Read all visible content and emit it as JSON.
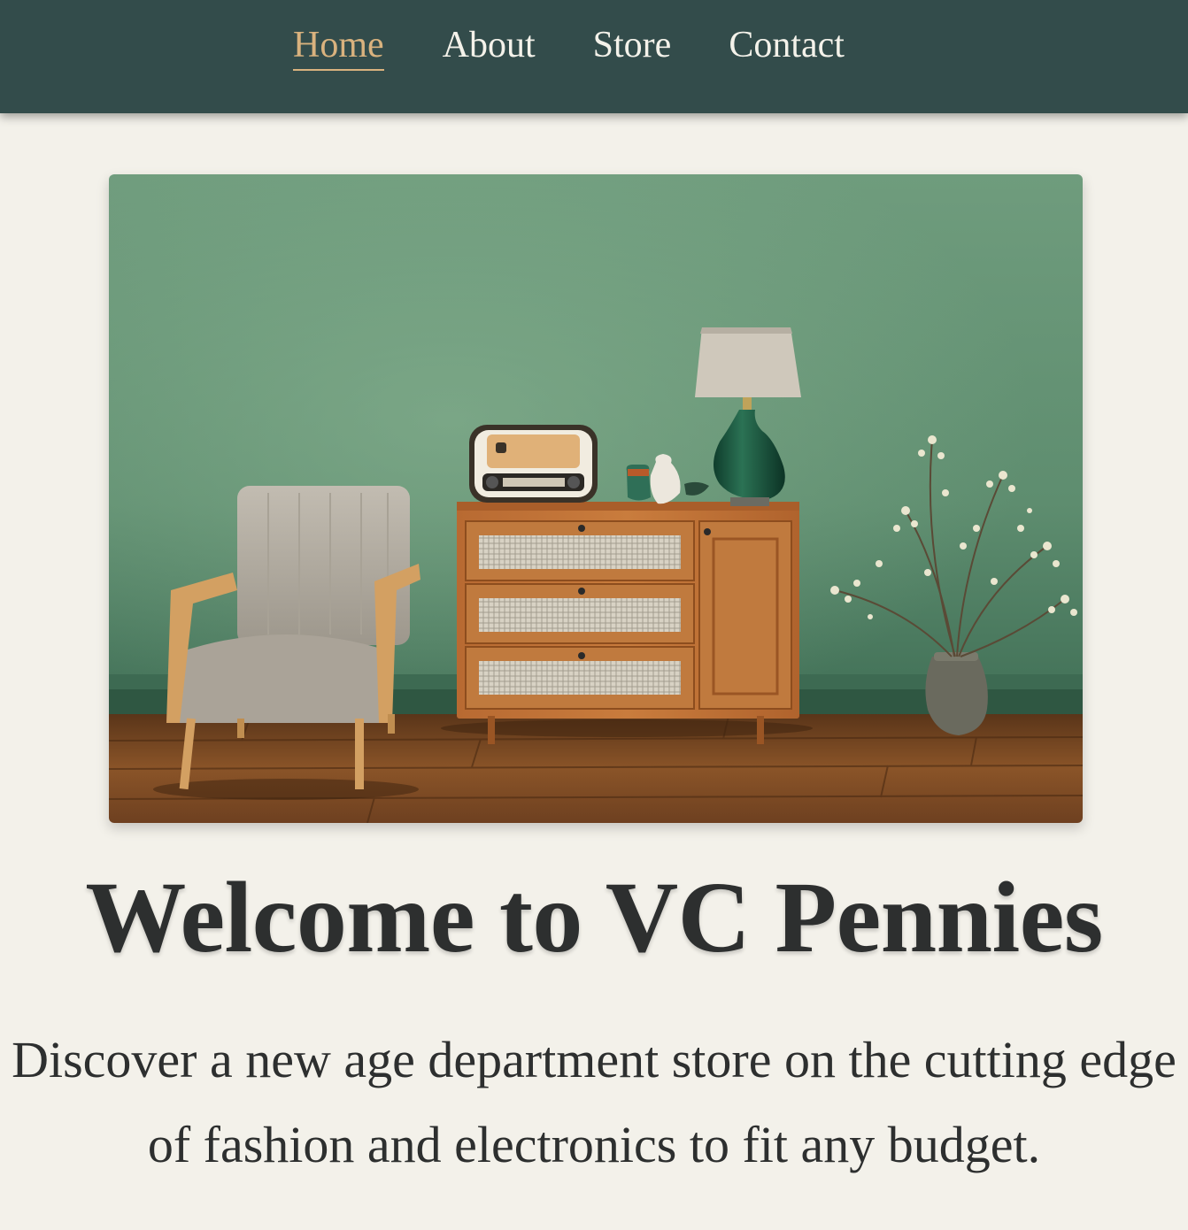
{
  "nav": {
    "items": [
      {
        "label": "Home",
        "active": true
      },
      {
        "label": "About",
        "active": false
      },
      {
        "label": "Store",
        "active": false
      },
      {
        "label": "Contact",
        "active": false
      }
    ]
  },
  "hero": {
    "title": "Welcome to VC Pennies",
    "tagline": "Discover a new age department store on the cutting edge of fashion and electronics to fit any budget."
  },
  "colors": {
    "navbar_bg": "#334c4b",
    "nav_active": "#d9b27e",
    "nav_text": "#f4f2ea",
    "page_bg": "#f3f1ea",
    "heading_text": "#2d2f2f"
  }
}
